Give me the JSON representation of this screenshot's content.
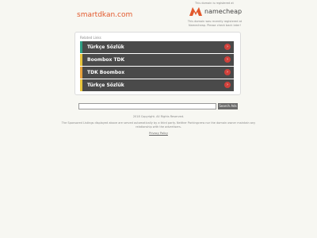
{
  "header": {
    "domain": "smartdkan.com",
    "registrar_note": "This domain is registered at",
    "registrar_name": "namecheap",
    "registrar_sub": "This domain was recently registered at Namecheap. Please check back later!"
  },
  "related": {
    "label": "Related Links",
    "links": [
      {
        "label": "Türkçe Sözlük",
        "accent": "#2e9e83"
      },
      {
        "label": "Boombox TDK",
        "accent": "#e8c43a"
      },
      {
        "label": "TDK Boombox",
        "accent": "#e8a23a"
      },
      {
        "label": "Türkçe Sözlük",
        "accent": "#e8c43a"
      }
    ],
    "arrow_glyph": "›"
  },
  "search": {
    "value": "",
    "button_label": "Search Ads"
  },
  "footer": {
    "copyright": "2018 Copyright. All Rights Reserved.",
    "disclaimer": "The Sponsored Listings displayed above are served automatically by a third party. Neither Parkingcrew nor the domain owner maintain any relationship with the advertisers.",
    "privacy": "Privacy Policy"
  },
  "colors": {
    "domain": "#e2582c",
    "registrar_logo": "#e2582c",
    "arrow": "#d1413b"
  }
}
